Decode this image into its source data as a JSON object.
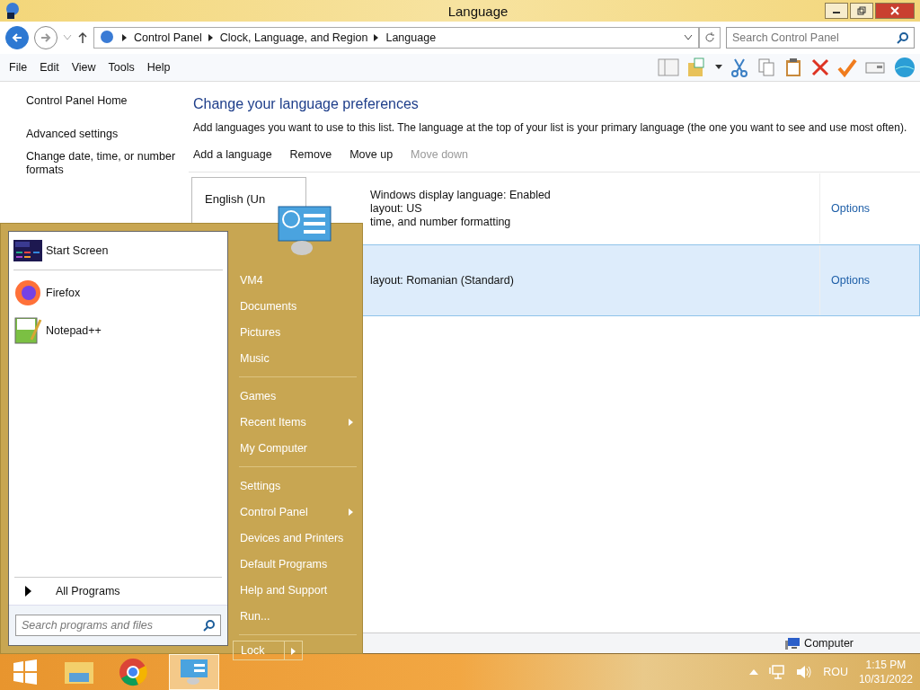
{
  "window": {
    "title": "Language"
  },
  "address": {
    "crumbs": [
      "Control Panel",
      "Clock, Language, and Region",
      "Language"
    ],
    "search_placeholder": "Search Control Panel"
  },
  "menu": [
    "File",
    "Edit",
    "View",
    "Tools",
    "Help"
  ],
  "sidebar": {
    "items": [
      "Control Panel Home",
      "Advanced settings",
      "Change date, time, or number formats"
    ]
  },
  "heading": "Change your language preferences",
  "description": "Add languages you want to use to this list. The language at the top of your list is your primary language (the one you want to see and use most often).",
  "actions": [
    {
      "label": "Add a language",
      "disabled": false
    },
    {
      "label": "Remove",
      "disabled": false
    },
    {
      "label": "Move up",
      "disabled": false
    },
    {
      "label": "Move down",
      "disabled": true
    }
  ],
  "languages": [
    {
      "name": "English (Un",
      "details": [
        "Windows display language: Enabled",
        "layout: US",
        "time, and number formatting"
      ],
      "options": "Options",
      "selected": false
    },
    {
      "details": [
        "layout: Romanian (Standard)"
      ],
      "options": "Options",
      "selected": true
    }
  ],
  "status_bar": {
    "location": "Computer"
  },
  "start_menu": {
    "pinned": [
      {
        "label": "Start Screen",
        "kind": "start"
      },
      {
        "label": "Firefox",
        "kind": "firefox"
      },
      {
        "label": "Notepad++",
        "kind": "notepad"
      }
    ],
    "all_programs": "All Programs",
    "search_placeholder": "Search programs and files",
    "groups": [
      [
        {
          "label": "VM4",
          "submenu": false
        },
        {
          "label": "Documents",
          "submenu": false
        },
        {
          "label": "Pictures",
          "submenu": false
        },
        {
          "label": "Music",
          "submenu": false
        }
      ],
      [
        {
          "label": "Games",
          "submenu": false
        },
        {
          "label": "Recent Items",
          "submenu": true
        },
        {
          "label": "My Computer",
          "submenu": false
        }
      ],
      [
        {
          "label": "Settings",
          "submenu": false
        },
        {
          "label": "Control Panel",
          "submenu": true
        },
        {
          "label": "Devices and Printers",
          "submenu": false
        },
        {
          "label": "Default Programs",
          "submenu": false
        },
        {
          "label": "Help and Support",
          "submenu": false
        },
        {
          "label": "Run...",
          "submenu": false
        }
      ]
    ],
    "lock": "Lock"
  },
  "taskbar": {
    "language": "ROU",
    "time": "1:15 PM",
    "date": "10/31/2022"
  }
}
